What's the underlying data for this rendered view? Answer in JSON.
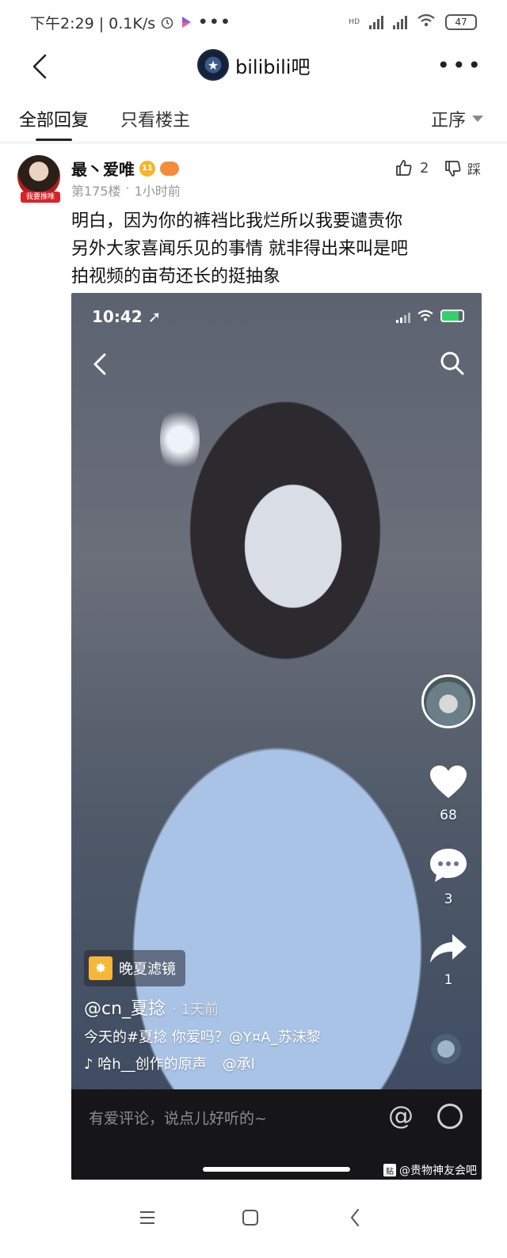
{
  "status_bar": {
    "time_speed": "下午2:29 | 0.1K/s",
    "network_label": "HD",
    "battery": "47"
  },
  "nav": {
    "forum_name": "bilibili吧"
  },
  "tabs": {
    "all_replies": "全部回复",
    "op_only": "只看楼主",
    "sort": "正序"
  },
  "post": {
    "author": "最丶爱唯",
    "level": "11",
    "avatar_tag": "我要推唯",
    "floor": "第175楼",
    "separator": "·",
    "time": "1小时前",
    "like_count": "2",
    "dislike_label": "踩",
    "lines": [
      "明白，因为你的裤裆比我烂所以我要谴责你",
      "另外大家喜闻乐见的事情 就非得出来叫是吧",
      "拍视频的亩苟还长的挺抽象"
    ]
  },
  "screenshot": {
    "time": "10:42",
    "like_count": "68",
    "comment_count": "3",
    "share_count": "1",
    "filter_label": "晚夏滤镜",
    "video_author": "@cn_夏捻",
    "video_time": "· 1天前",
    "caption": "今天的#夏捻 你爱吗？@Y¤A_苏沫黎",
    "music_source": "♪ 哈h__创作的原声",
    "music_mention": "@承l",
    "comment_placeholder": "有爱评论，说点儿好听的~",
    "watermark": "@贵物神友会吧",
    "watermark_icon": "贴"
  }
}
